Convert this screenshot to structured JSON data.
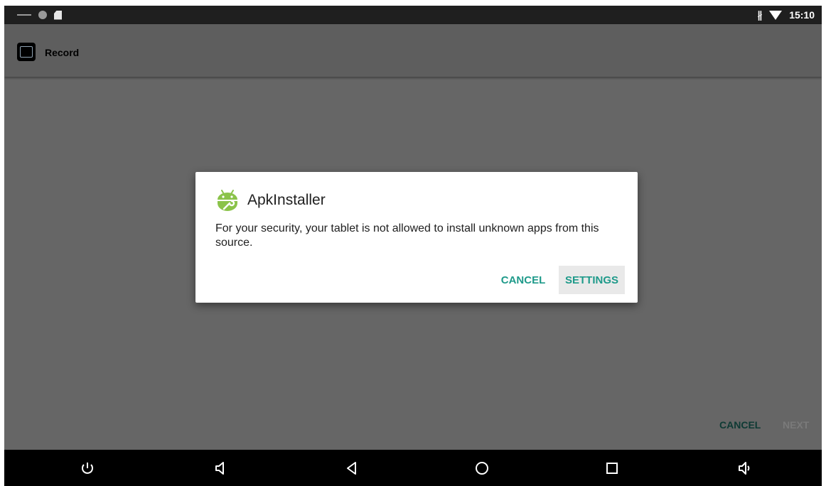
{
  "status_bar": {
    "time": "15:10",
    "bluetooth_symbol": "∦",
    "icons": [
      "minus-icon",
      "circle-icon",
      "sd-card-icon",
      "bluetooth-icon",
      "wifi-icon"
    ]
  },
  "app_bar": {
    "title": "Record",
    "icon": "record-app-icon"
  },
  "dialog": {
    "title": "ApkInstaller",
    "icon": "android-wrench-icon",
    "message": "For your security, your tablet is not allowed to install unknown apps from this source.",
    "cancel_label": "CANCEL",
    "settings_label": "SETTINGS",
    "accent_color": "#1e9a8a"
  },
  "wizard": {
    "cancel_label": "CANCEL",
    "next_label": "NEXT"
  },
  "nav_bar": {
    "buttons": [
      "power-icon",
      "volume-down-icon",
      "back-icon",
      "home-icon",
      "recents-icon",
      "volume-up-icon"
    ]
  }
}
